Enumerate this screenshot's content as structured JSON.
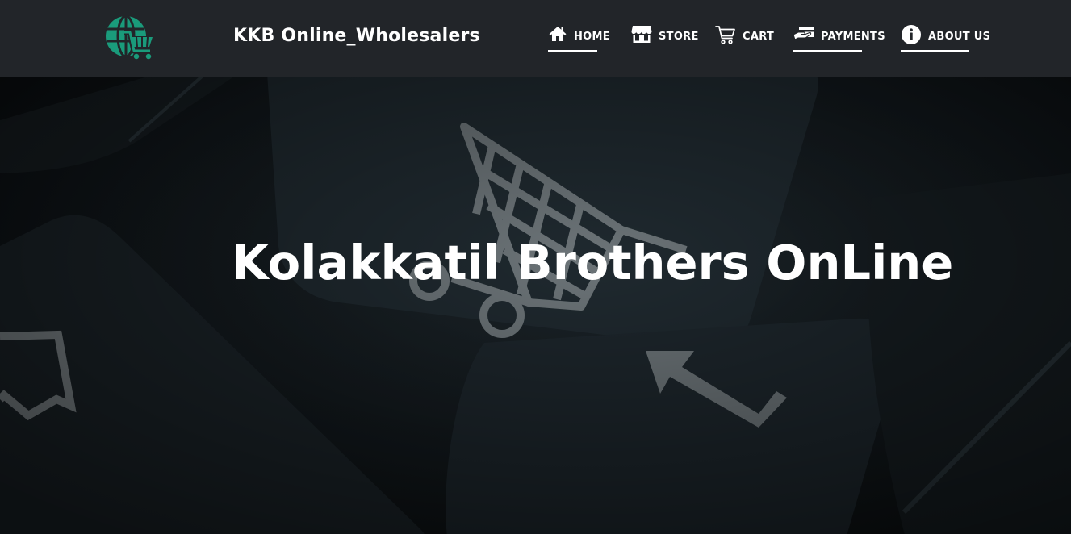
{
  "header": {
    "brand_name": "KKB Online_Wholesalers",
    "logo_icon": "globe-cart-icon",
    "accent_color": "#1a9b7b"
  },
  "nav": {
    "items": [
      {
        "label": "HOME",
        "icon": "home-icon",
        "active": true
      },
      {
        "label": "STORE",
        "icon": "store-icon",
        "active": false
      },
      {
        "label": "CART",
        "icon": "cart-icon",
        "active": false
      },
      {
        "label": "PAYMENTS",
        "icon": "payment-card-icon",
        "active": true
      },
      {
        "label": "ABOUT US",
        "icon": "info-icon",
        "active": true
      }
    ]
  },
  "hero": {
    "title": "Kolakkatil Brothers OnLine"
  }
}
